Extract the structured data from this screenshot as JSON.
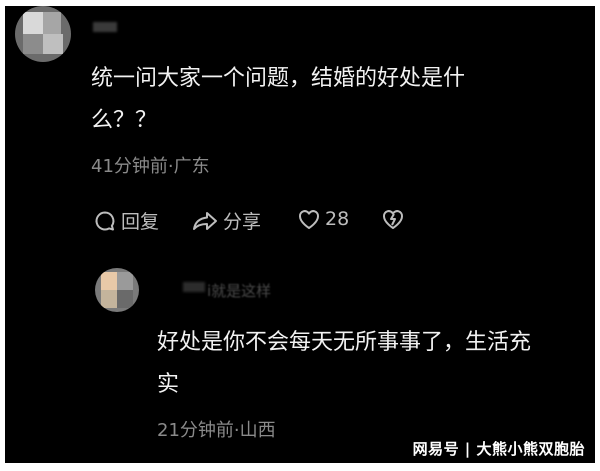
{
  "comment": {
    "text_line1": "统一问大家一个问题，结婚的好处是什",
    "text_line2": "么？？",
    "meta": "41分钟前·广东",
    "actions": {
      "reply_label": "回复",
      "share_label": "分享",
      "like_count": "28"
    }
  },
  "reply": {
    "author_fragment": "i就是这样",
    "text_line1": "好处是你不会每天无所事事了，生活充",
    "text_line2": "实",
    "meta": "21分钟前·山西"
  },
  "watermark": "网易号 | 大熊小熊双胞胎",
  "icons": [
    "reply-icon",
    "share-icon",
    "heart-icon",
    "broken-heart-icon"
  ]
}
